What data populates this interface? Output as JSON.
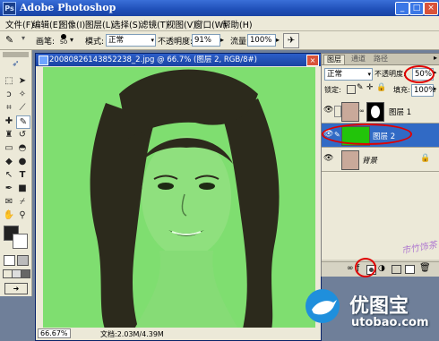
{
  "app": {
    "title": "Adobe Photoshop",
    "icon_label": "Ps"
  },
  "window_controls": {
    "minimize": "_",
    "maximize": "□",
    "close": "×"
  },
  "menu": [
    "文件(F)",
    "编辑(E)",
    "图像(I)",
    "图层(L)",
    "选择(S)",
    "滤镜(T)",
    "视图(V)",
    "窗口(W)",
    "帮助(H)"
  ],
  "options": {
    "brush_label": "画笔:",
    "brush_size": "50",
    "mode_label": "模式:",
    "mode_value": "正常",
    "opacity_label": "不透明度:",
    "opacity_value": "91%",
    "flow_label": "流量:",
    "flow_value": "100%"
  },
  "document": {
    "title": "20080826143852238_2.jpg @ 66.7% (图层 2, RGB/8#)",
    "zoom": "66.67%",
    "status": "文档:2.03M/4.39M"
  },
  "layers_panel": {
    "tabs": [
      "图层",
      "通道",
      "路径"
    ],
    "blend_mode": "正常",
    "opacity_label": "不透明度:",
    "opacity_value": "50%",
    "lock_label": "锁定:",
    "fill_label": "填充:",
    "fill_value": "100%",
    "layers": [
      {
        "name": "图层 1",
        "selected": false
      },
      {
        "name": "图层 2",
        "selected": true
      },
      {
        "name": "背景",
        "selected": false
      }
    ]
  },
  "watermark": {
    "brand": "优图宝",
    "url": "utobao.com",
    "sub": "市竹饰茶"
  },
  "colors": {
    "overlay_green": "#7fde70",
    "highlight_red": "#e00000",
    "selected_layer": "#316ac5"
  }
}
